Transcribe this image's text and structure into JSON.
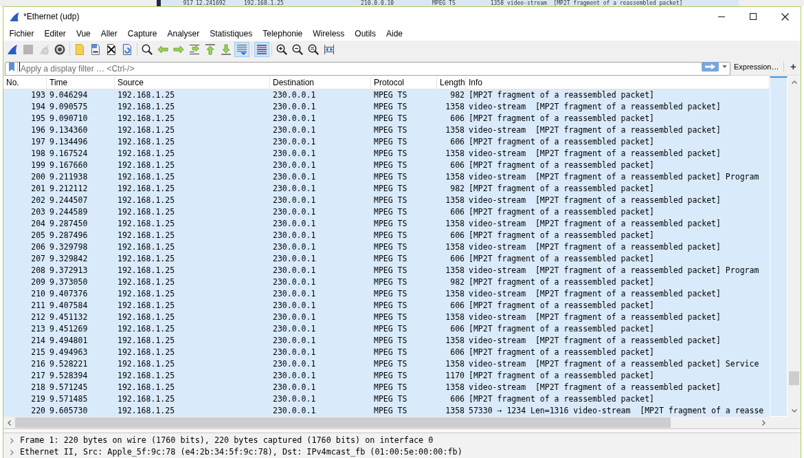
{
  "background_window": {
    "packet_row": {
      "no": "917",
      "time": "12.241692",
      "source": "192.168.1.25",
      "destination": "210.0.0.10",
      "protocol": "MPEG TS",
      "length": "1358",
      "info": "video-stream  [MP2T fragment of a reassembled packet]"
    }
  },
  "window": {
    "title": "*Ethernet (udp)"
  },
  "menu": [
    "Fichier",
    "Editer",
    "Vue",
    "Aller",
    "Capture",
    "Analyser",
    "Statistiques",
    "Telephonie",
    "Wireless",
    "Outils",
    "Aide"
  ],
  "toolbar": [
    {
      "on": false,
      "disabled": false
    },
    {
      "on": false,
      "disabled": true
    },
    {
      "on": false,
      "disabled": true
    },
    {
      "on": false,
      "disabled": false
    },
    {
      "on": false,
      "disabled": false
    },
    {
      "on": false,
      "disabled": false
    },
    {
      "on": false,
      "disabled": false
    },
    {
      "on": false,
      "disabled": false
    },
    {
      "on": false,
      "disabled": false
    },
    {
      "on": false,
      "disabled": false
    },
    {
      "on": false,
      "disabled": false
    },
    {
      "on": false,
      "disabled": false
    },
    {
      "on": false,
      "disabled": false
    },
    {
      "on": false,
      "disabled": false
    },
    {
      "on": true,
      "disabled": false
    },
    {
      "on": true,
      "disabled": false
    },
    {
      "on": false,
      "disabled": false
    },
    {
      "on": false,
      "disabled": false
    },
    {
      "on": false,
      "disabled": false
    },
    {
      "on": false,
      "disabled": false
    }
  ],
  "filter_bar": {
    "placeholder": "Apply a display filter … <Ctrl-/>",
    "expression_button": "Expression…",
    "add_button": "+"
  },
  "packet_list": {
    "columns": [
      "No.",
      "Time",
      "Source",
      "Destination",
      "Protocol",
      "Length",
      "Info"
    ],
    "rows": [
      {
        "no": "193",
        "time": "9.046294",
        "source": "192.168.1.25",
        "destination": "230.0.0.1",
        "protocol": "MPEG TS",
        "length": "982",
        "info": "[MP2T fragment of a reassembled packet]"
      },
      {
        "no": "194",
        "time": "9.090575",
        "source": "192.168.1.25",
        "destination": "230.0.0.1",
        "protocol": "MPEG TS",
        "length": "1358",
        "info": "video-stream  [MP2T fragment of a reassembled packet]"
      },
      {
        "no": "195",
        "time": "9.090710",
        "source": "192.168.1.25",
        "destination": "230.0.0.1",
        "protocol": "MPEG TS",
        "length": "606",
        "info": "[MP2T fragment of a reassembled packet]"
      },
      {
        "no": "196",
        "time": "9.134360",
        "source": "192.168.1.25",
        "destination": "230.0.0.1",
        "protocol": "MPEG TS",
        "length": "1358",
        "info": "video-stream  [MP2T fragment of a reassembled packet]"
      },
      {
        "no": "197",
        "time": "9.134496",
        "source": "192.168.1.25",
        "destination": "230.0.0.1",
        "protocol": "MPEG TS",
        "length": "606",
        "info": "[MP2T fragment of a reassembled packet]"
      },
      {
        "no": "198",
        "time": "9.167524",
        "source": "192.168.1.25",
        "destination": "230.0.0.1",
        "protocol": "MPEG TS",
        "length": "1358",
        "info": "video-stream  [MP2T fragment of a reassembled packet]"
      },
      {
        "no": "199",
        "time": "9.167660",
        "source": "192.168.1.25",
        "destination": "230.0.0.1",
        "protocol": "MPEG TS",
        "length": "606",
        "info": "[MP2T fragment of a reassembled packet]"
      },
      {
        "no": "200",
        "time": "9.211938",
        "source": "192.168.1.25",
        "destination": "230.0.0.1",
        "protocol": "MPEG TS",
        "length": "1358",
        "info": "video-stream  [MP2T fragment of a reassembled packet] Program"
      },
      {
        "no": "201",
        "time": "9.212112",
        "source": "192.168.1.25",
        "destination": "230.0.0.1",
        "protocol": "MPEG TS",
        "length": "982",
        "info": "[MP2T fragment of a reassembled packet]"
      },
      {
        "no": "202",
        "time": "9.244507",
        "source": "192.168.1.25",
        "destination": "230.0.0.1",
        "protocol": "MPEG TS",
        "length": "1358",
        "info": "video-stream  [MP2T fragment of a reassembled packet]"
      },
      {
        "no": "203",
        "time": "9.244589",
        "source": "192.168.1.25",
        "destination": "230.0.0.1",
        "protocol": "MPEG TS",
        "length": "606",
        "info": "[MP2T fragment of a reassembled packet]"
      },
      {
        "no": "204",
        "time": "9.287450",
        "source": "192.168.1.25",
        "destination": "230.0.0.1",
        "protocol": "MPEG TS",
        "length": "1358",
        "info": "video-stream  [MP2T fragment of a reassembled packet]"
      },
      {
        "no": "205",
        "time": "9.287496",
        "source": "192.168.1.25",
        "destination": "230.0.0.1",
        "protocol": "MPEG TS",
        "length": "606",
        "info": "[MP2T fragment of a reassembled packet]"
      },
      {
        "no": "206",
        "time": "9.329798",
        "source": "192.168.1.25",
        "destination": "230.0.0.1",
        "protocol": "MPEG TS",
        "length": "1358",
        "info": "video-stream  [MP2T fragment of a reassembled packet]"
      },
      {
        "no": "207",
        "time": "9.329842",
        "source": "192.168.1.25",
        "destination": "230.0.0.1",
        "protocol": "MPEG TS",
        "length": "606",
        "info": "[MP2T fragment of a reassembled packet]"
      },
      {
        "no": "208",
        "time": "9.372913",
        "source": "192.168.1.25",
        "destination": "230.0.0.1",
        "protocol": "MPEG TS",
        "length": "1358",
        "info": "video-stream  [MP2T fragment of a reassembled packet] Program"
      },
      {
        "no": "209",
        "time": "9.373050",
        "source": "192.168.1.25",
        "destination": "230.0.0.1",
        "protocol": "MPEG TS",
        "length": "982",
        "info": "[MP2T fragment of a reassembled packet]"
      },
      {
        "no": "210",
        "time": "9.407376",
        "source": "192.168.1.25",
        "destination": "230.0.0.1",
        "protocol": "MPEG TS",
        "length": "1358",
        "info": "video-stream  [MP2T fragment of a reassembled packet]"
      },
      {
        "no": "211",
        "time": "9.407584",
        "source": "192.168.1.25",
        "destination": "230.0.0.1",
        "protocol": "MPEG TS",
        "length": "606",
        "info": "[MP2T fragment of a reassembled packet]"
      },
      {
        "no": "212",
        "time": "9.451132",
        "source": "192.168.1.25",
        "destination": "230.0.0.1",
        "protocol": "MPEG TS",
        "length": "1358",
        "info": "video-stream  [MP2T fragment of a reassembled packet]"
      },
      {
        "no": "213",
        "time": "9.451269",
        "source": "192.168.1.25",
        "destination": "230.0.0.1",
        "protocol": "MPEG TS",
        "length": "606",
        "info": "[MP2T fragment of a reassembled packet]"
      },
      {
        "no": "214",
        "time": "9.494801",
        "source": "192.168.1.25",
        "destination": "230.0.0.1",
        "protocol": "MPEG TS",
        "length": "1358",
        "info": "video-stream  [MP2T fragment of a reassembled packet]"
      },
      {
        "no": "215",
        "time": "9.494963",
        "source": "192.168.1.25",
        "destination": "230.0.0.1",
        "protocol": "MPEG TS",
        "length": "606",
        "info": "[MP2T fragment of a reassembled packet]"
      },
      {
        "no": "216",
        "time": "9.528221",
        "source": "192.168.1.25",
        "destination": "230.0.0.1",
        "protocol": "MPEG TS",
        "length": "1358",
        "info": "video-stream  [MP2T fragment of a reassembled packet] Service"
      },
      {
        "no": "217",
        "time": "9.528394",
        "source": "192.168.1.25",
        "destination": "230.0.0.1",
        "protocol": "MPEG TS",
        "length": "1170",
        "info": "[MP2T fragment of a reassembled packet]"
      },
      {
        "no": "218",
        "time": "9.571245",
        "source": "192.168.1.25",
        "destination": "230.0.0.1",
        "protocol": "MPEG TS",
        "length": "1358",
        "info": "video-stream  [MP2T fragment of a reassembled packet]"
      },
      {
        "no": "219",
        "time": "9.571485",
        "source": "192.168.1.25",
        "destination": "230.0.0.1",
        "protocol": "MPEG TS",
        "length": "606",
        "info": "[MP2T fragment of a reassembled packet]"
      },
      {
        "no": "220",
        "time": "9.605730",
        "source": "192.168.1.25",
        "destination": "230.0.0.1",
        "protocol": "MPEG TS",
        "length": "1358",
        "info": "57330 → 1234 Len=1316 video-stream  [MP2T fragment of a reasse"
      }
    ]
  },
  "packet_details": [
    {
      "text": "Frame 1: 220 bytes on wire (1760 bits), 220 bytes captured (1760 bits) on interface 0",
      "expanded": false
    },
    {
      "text": "Ethernet II, Src: Apple_5f:9c:78 (e4:2b:34:5f:9c:78), Dst: IPv4mcast_fb (01:00:5e:00:00:fb)",
      "expanded": false
    }
  ]
}
